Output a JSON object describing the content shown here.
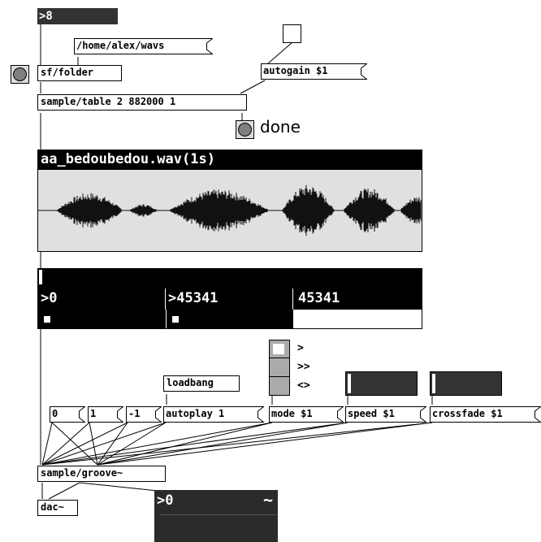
{
  "top_numbox": {
    "value": ">8"
  },
  "path_message": {
    "text": "/home/alex/wavs"
  },
  "sf_folder": {
    "text": "sf/folder"
  },
  "autogain_message": {
    "text": "autogain $1"
  },
  "sample_table": {
    "text": "sample/table 2 882000 1"
  },
  "done_label": {
    "text": "done"
  },
  "waveform": {
    "title": "aa_bedoubedou.wav(1s)",
    "colors": {
      "background": "#e0e0e0",
      "wave": "#111111",
      "header": "#000000"
    }
  },
  "position_display": {
    "cells": [
      {
        "value": ">0"
      },
      {
        "value": ">45341"
      },
      {
        "value": "45341"
      }
    ]
  },
  "mode_radio": {
    "labels": [
      ">",
      ">>",
      "<>"
    ]
  },
  "loadbang": {
    "text": "loadbang"
  },
  "messages": {
    "zero": "0",
    "one": "1",
    "minus_one": "-1",
    "autoplay": "autoplay 1",
    "mode": "mode $1",
    "speed": "speed $1",
    "crossfade": "crossfade $1"
  },
  "sample_groove": {
    "text": "sample/groove~"
  },
  "dac": {
    "text": "dac~"
  },
  "signal_numbox": {
    "value": ">0",
    "tilde": "~"
  }
}
